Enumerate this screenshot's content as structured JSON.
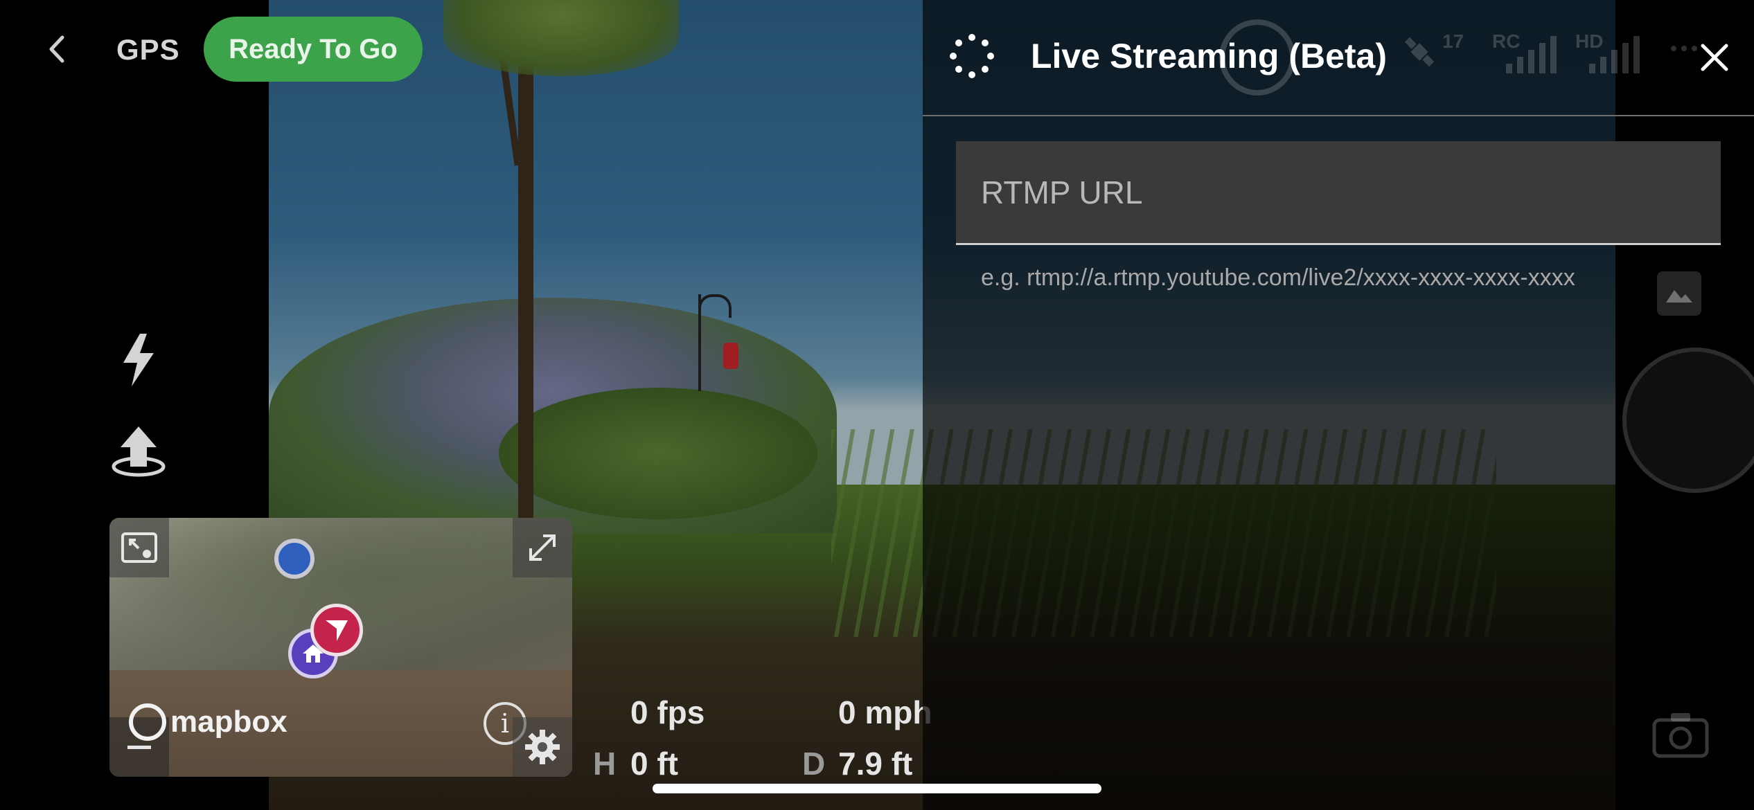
{
  "header": {
    "gps_label": "GPS",
    "status": "Ready To Go"
  },
  "hud_background": {
    "satellite_count": "17",
    "rc_label": "RC",
    "hd_label": "HD"
  },
  "map": {
    "attribution": "mapbox",
    "info_glyph": "i"
  },
  "telemetry": {
    "fps": "0 fps",
    "speed": "0 mph",
    "height_key": "H",
    "height": "0 ft",
    "distance_key": "D",
    "distance": "7.9 ft"
  },
  "live_stream": {
    "title": "Live Streaming (Beta)",
    "url_placeholder": "RTMP URL",
    "url_value": "",
    "hint": "e.g. rtmp://a.rtmp.youtube.com/live2/xxxx-xxxx-xxxx-xxxx"
  },
  "icons": {
    "back": "chevron-left-icon",
    "flash": "lightning-icon",
    "takeoff": "takeoff-icon",
    "map_minimize": "minimize-map-icon",
    "map_expand": "expand-icon",
    "map_settings": "gear-icon",
    "spinner": "loading-spinner-icon",
    "close": "close-icon",
    "camera": "camera-icon",
    "gallery": "image-icon"
  },
  "colors": {
    "status_green": "#3da34a",
    "user_pin": "#2e5fbd",
    "home_pin": "#5a3fbd",
    "drone_pin": "#c4234b"
  }
}
